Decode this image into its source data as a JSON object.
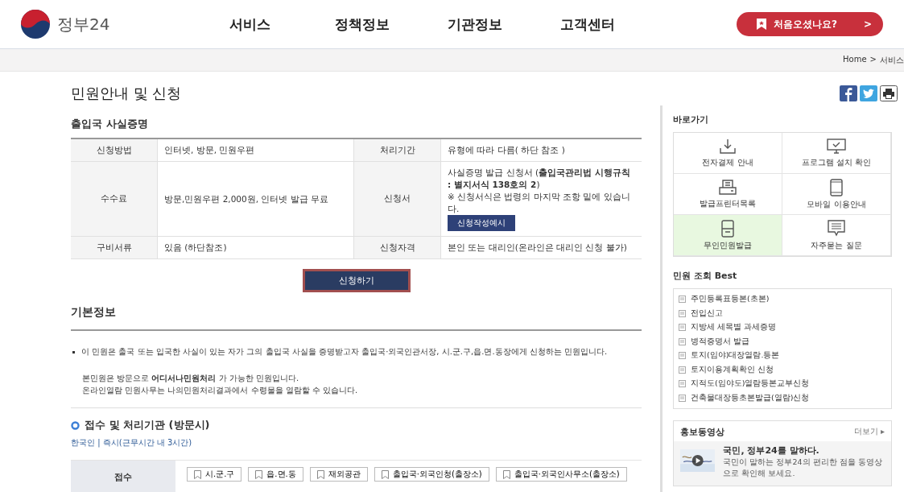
{
  "header": {
    "logo_text": "정부24",
    "nav": [
      {
        "label": "서비스"
      },
      {
        "label": "정책정보"
      },
      {
        "label": "기관정보"
      },
      {
        "label": "고객센터"
      }
    ],
    "first_visit_button": "처음오셨나요?",
    "first_visit_arrow": ">"
  },
  "breadcrumb": {
    "items": [
      "Home",
      "서비스"
    ],
    "separator": ">"
  },
  "page_title": "민원안내 및 신청",
  "summary": {
    "title": "출입국 사실증명",
    "rows": [
      {
        "label": "신청방법",
        "value": "인터넷, 방문, 민원우편",
        "label2": "처리기간",
        "value2": "유형에 따라 다름( 하단 참조 )"
      },
      {
        "label": "수수료",
        "value": "방문,민원우편 2,000원, 인터넷 발급 무료",
        "label2": "신청서",
        "value2": "사실증명 발급 신청서 (**출입국관리법 시행규칙 : 별지서식 138호의 2**)",
        "note": "※ 신청서식은 법령의 마지막 조항 밑에 있습니다.",
        "example_button": "신청작성예시"
      },
      {
        "label": "구비서류",
        "value": "있음 (하단참조)",
        "label2": "신청자격",
        "value2": "본인 또는 대리인(온라인은 대리인 신청 불가)"
      }
    ],
    "apply_button": "신청하기"
  },
  "basic_info": {
    "title": "기본정보",
    "bullet": "이 민원은 출국 또는 입국한 사실이 있는 자가 그의 출입국 사실을 증명받고자 출입국·외국인관서장, 시.군.구,읍.면.동장에게 신청하는 민원입니다.",
    "para1": "본민원은 방문으로 **어디서나민원처리** 가 가능한 민원입니다.",
    "para2": "온라인열람 민원사무는 나의민원처리결과에서 수령물을 열람할 수 있습니다."
  },
  "agencies": {
    "title": "접수 및 처리기관 (방문시)",
    "subtitle": "한국인 | 즉시(근무시간 내 3시간)",
    "row_label": "접수",
    "offices": [
      "시.군.구",
      "읍.면.동",
      "재외공관",
      "출입국·외국인청(출장소)",
      "출입국·외국인사무소(출장소)"
    ]
  },
  "sidebar": {
    "shortcuts_title": "바로가기",
    "shortcuts": [
      {
        "label": "전자결제 안내",
        "kind": "download",
        "selected": false
      },
      {
        "label": "프로그램 설치 확인",
        "kind": "monitor",
        "selected": false
      },
      {
        "label": "발급프린터목록",
        "kind": "printer",
        "selected": false
      },
      {
        "label": "모바일 이용안내",
        "kind": "mobile",
        "selected": false
      },
      {
        "label": "무인민원발급",
        "kind": "kiosk",
        "selected": true
      },
      {
        "label": "자주묻는 질문",
        "kind": "chat",
        "selected": false
      }
    ],
    "best_title": "민원 조회 Best",
    "best": [
      "주민등록표등본(초본)",
      "전입신고",
      "지방세 세목별 과세증명",
      "병적증명서 발급",
      "토지(임야)대장열람.등본",
      "토지이용계획확인 신청",
      "지적도(임야도)열람등본교부신청",
      "건축물대장등초본발급(열람)신청"
    ],
    "video": {
      "title": "홍보동영상",
      "more": "더보기 ▸",
      "headline": "국민, 정부24를 말하다.",
      "desc": "국민이 말하는 정부24의 편리한 점을 동영상으로 확인해 보세요."
    }
  }
}
